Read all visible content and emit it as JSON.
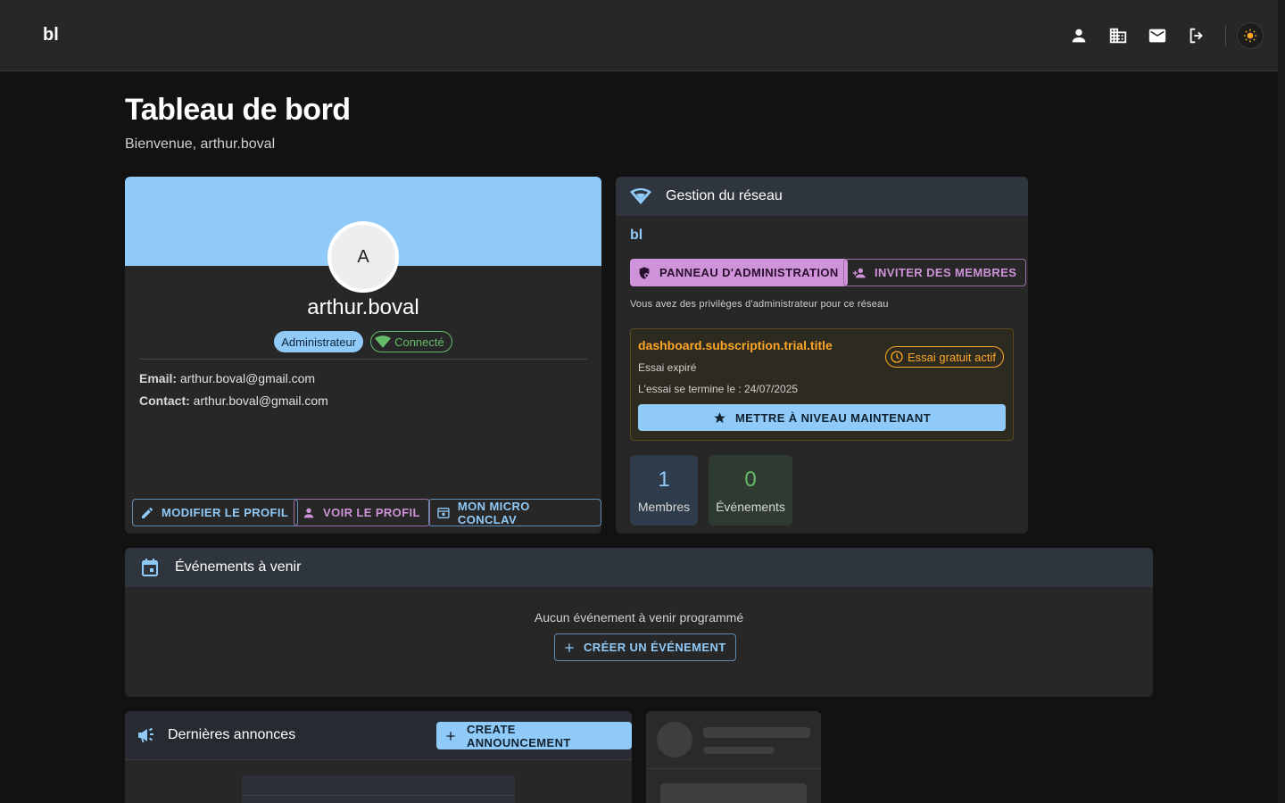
{
  "topbar": {
    "brand": "bl",
    "icons": [
      "person-icon",
      "business-icon",
      "mail-icon",
      "logout-icon",
      "sun-icon"
    ]
  },
  "page": {
    "title": "Tableau de bord",
    "subtitle": "Bienvenue, arthur.boval"
  },
  "profile": {
    "avatar_letter": "A",
    "username": "arthur.boval",
    "role_chip": "Administrateur",
    "status_chip": "Connecté",
    "email_label": "Email:",
    "email_value": "arthur.boval@gmail.com",
    "contact_label": "Contact:",
    "contact_value": "arthur.boval@gmail.com",
    "edit_button": "MODIFIER LE PROFIL",
    "view_button": "VOIR LE PROFIL",
    "micro_button": "MON MICRO CONCLAV",
    "banner_color": "#90caf9"
  },
  "network": {
    "header": "Gestion du réseau",
    "name": "bl",
    "admin_button": "PANNEAU D'ADMINISTRATION",
    "invite_button": "INVITER DES MEMBRES",
    "privileges_text": "Vous avez des privilèges d'administrateur pour ce réseau",
    "trial": {
      "title": "dashboard.subscription.trial.title",
      "chip": "Essai gratuit actif",
      "expired": "Essai expiré",
      "end_text": "L'essai se termine le : 24/07/2025",
      "upgrade_button": "METTRE À NIVEAU MAINTENANT"
    },
    "stats": {
      "members_count": "1",
      "members_label": "Membres",
      "events_count": "0",
      "events_label": "Événements"
    }
  },
  "events": {
    "header": "Événements à venir",
    "empty_text": "Aucun événement à venir programmé",
    "create_button": "CRÉER UN ÉVÉNEMENT"
  },
  "announcements": {
    "header": "Dernières annonces",
    "create_button": "CREATE ANNOUNCEMENT"
  },
  "colors": {
    "accent_blue": "#90caf9",
    "accent_purple": "#ce93d8",
    "success": "#66bb6a",
    "warning": "#ffa726"
  }
}
